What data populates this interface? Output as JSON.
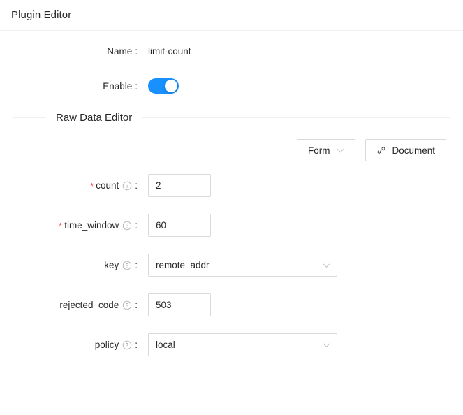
{
  "header": {
    "title": "Plugin Editor"
  },
  "meta": {
    "name_label": "Name",
    "name_value": "limit-count",
    "enable_label": "Enable",
    "enable_on": true
  },
  "divider": {
    "title": "Raw Data Editor"
  },
  "toolbar": {
    "form_label": "Form",
    "document_label": "Document"
  },
  "colon": ":",
  "fields": [
    {
      "label": "count",
      "required": true,
      "type": "input",
      "value": "2",
      "placeholder": ""
    },
    {
      "label": "time_window",
      "required": true,
      "type": "input",
      "value": "60",
      "placeholder": ""
    },
    {
      "label": "key",
      "required": false,
      "type": "select",
      "value": "remote_addr",
      "placeholder": ""
    },
    {
      "label": "rejected_code",
      "required": false,
      "type": "input",
      "value": "503",
      "placeholder": ""
    },
    {
      "label": "policy",
      "required": false,
      "type": "select",
      "value": "local",
      "placeholder": ""
    }
  ],
  "icons": {
    "help": "question-circle-icon",
    "chevron_down": "chevron-down-icon",
    "link": "link-icon"
  },
  "colors": {
    "accent": "#1890ff",
    "required_star": "#ff4d4f",
    "border": "#d9d9d9",
    "divider": "#f0f0f0"
  }
}
